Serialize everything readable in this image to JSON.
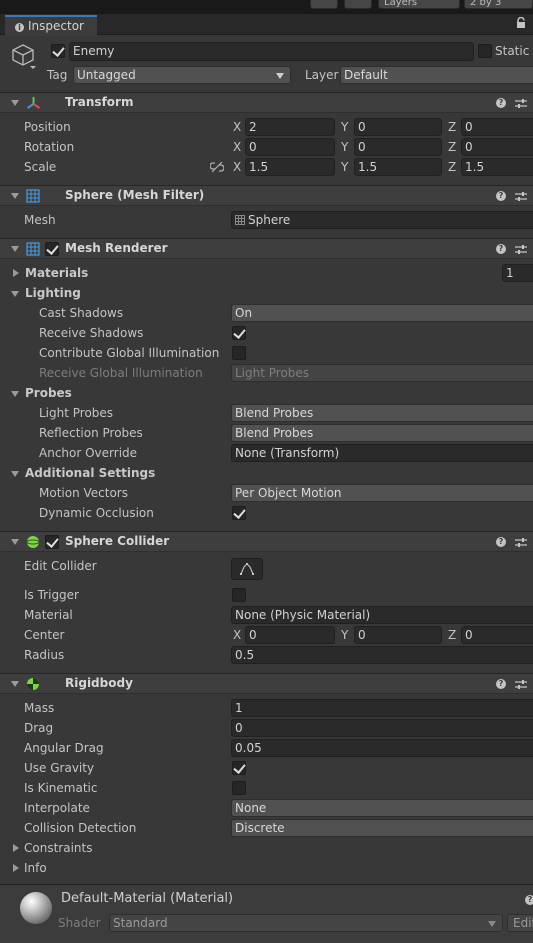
{
  "toolbar": {
    "layers": "Layers",
    "layout": "2 by 3"
  },
  "tab": {
    "title": "Inspector"
  },
  "object": {
    "name": "Enemy",
    "static_label": "Static",
    "tag_label": "Tag",
    "tag_value": "Untagged",
    "layer_label": "Layer",
    "layer_value": "Default"
  },
  "transform": {
    "title": "Transform",
    "position_label": "Position",
    "rotation_label": "Rotation",
    "scale_label": "Scale",
    "position": {
      "x": "2",
      "y": "0",
      "z": "0"
    },
    "rotation": {
      "x": "0",
      "y": "0",
      "z": "0"
    },
    "scale": {
      "x": "1.5",
      "y": "1.5",
      "z": "1.5"
    }
  },
  "axes": {
    "x": "X",
    "y": "Y",
    "z": "Z"
  },
  "mesh_filter": {
    "title": "Sphere (Mesh Filter)",
    "mesh_label": "Mesh",
    "mesh_value": "Sphere"
  },
  "mesh_renderer": {
    "title": "Mesh Renderer",
    "materials_label": "Materials",
    "materials_count": "1",
    "lighting_label": "Lighting",
    "cast_shadows_label": "Cast Shadows",
    "cast_shadows_value": "On",
    "receive_shadows_label": "Receive Shadows",
    "contribute_gi_label": "Contribute Global Illumination",
    "receive_gi_label": "Receive Global Illumination",
    "receive_gi_value": "Light Probes",
    "probes_label": "Probes",
    "light_probes_label": "Light Probes",
    "light_probes_value": "Blend Probes",
    "reflection_probes_label": "Reflection Probes",
    "reflection_probes_value": "Blend Probes",
    "anchor_override_label": "Anchor Override",
    "anchor_override_value": "None (Transform)",
    "additional_label": "Additional Settings",
    "motion_vectors_label": "Motion Vectors",
    "motion_vectors_value": "Per Object Motion",
    "dynamic_occlusion_label": "Dynamic Occlusion"
  },
  "sphere_collider": {
    "title": "Sphere Collider",
    "edit_collider_label": "Edit Collider",
    "is_trigger_label": "Is Trigger",
    "material_label": "Material",
    "material_value": "None (Physic Material)",
    "center_label": "Center",
    "center": {
      "x": "0",
      "y": "0",
      "z": "0"
    },
    "radius_label": "Radius",
    "radius_value": "0.5"
  },
  "rigidbody": {
    "title": "Rigidbody",
    "mass_label": "Mass",
    "mass_value": "1",
    "drag_label": "Drag",
    "drag_value": "0",
    "angular_drag_label": "Angular Drag",
    "angular_drag_value": "0.05",
    "use_gravity_label": "Use Gravity",
    "is_kinematic_label": "Is Kinematic",
    "interpolate_label": "Interpolate",
    "interpolate_value": "None",
    "collision_detection_label": "Collision Detection",
    "collision_detection_value": "Discrete",
    "constraints_label": "Constraints",
    "info_label": "Info"
  },
  "material": {
    "title": "Default-Material (Material)",
    "shader_label": "Shader",
    "shader_value": "Standard",
    "edit_label": "Edit"
  },
  "colors": {
    "accent": "#3a79bb",
    "background": "#383838",
    "header": "#3e3e3e",
    "field": "#2a2a2a"
  }
}
